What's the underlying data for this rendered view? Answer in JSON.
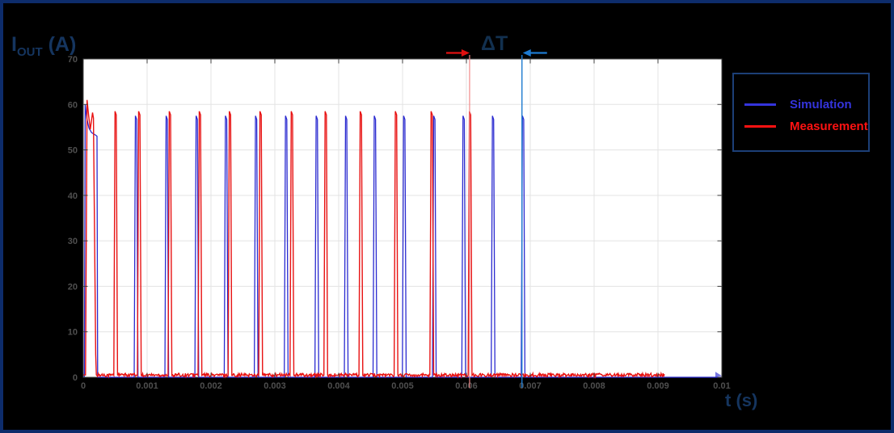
{
  "figure": {
    "background": "#000000",
    "border_color": "#0d2c6b"
  },
  "colors": {
    "plot_background": "#ffffff",
    "grid": "#e3e3e3",
    "axis_box": "#474747",
    "tick_text": "#4f4f4f",
    "axis_title_text": "#15355f",
    "simulation_line": "#2b2bd0",
    "measurement_line": "#e81212",
    "measurement_marker_arrow": "#e01010",
    "measurement_marker_line": "#f08888",
    "simulation_marker": "#1d7ad0"
  },
  "chart_data": {
    "type": "line",
    "title": "",
    "xlabel": "t (s)",
    "ylabel": "I_OUT (A)",
    "ylabel_parts": {
      "base": "I",
      "sub": "OUT",
      "rest": " (A)"
    },
    "xlim": [
      0,
      0.01
    ],
    "ylim": [
      0,
      70
    ],
    "grid": true,
    "legend_position": "outside upper right, black box",
    "x_ticks": {
      "values": [
        0,
        0.001,
        0.002,
        0.003,
        0.004,
        0.005,
        0.006,
        0.007,
        0.008,
        0.009,
        0.01
      ],
      "labels": [
        "0",
        "0.001",
        "0.002",
        "0.003",
        "0.004",
        "0.005",
        "0.006",
        "0.007",
        "0.008",
        "0.009",
        "0.01"
      ]
    },
    "y_ticks": {
      "values": [
        0,
        10,
        20,
        30,
        40,
        50,
        60,
        70
      ],
      "labels": [
        "0",
        "10",
        "20",
        "30",
        "40",
        "50",
        "60",
        "70"
      ]
    },
    "series": [
      {
        "name": "Simulation",
        "color": "#2b2bd0",
        "baseline_a": 0,
        "pulse_height_a": 57.5,
        "pulse_base_width_s": 6e-05,
        "first_pulse_t_v": [
          [
            1.8e-05,
            0
          ],
          [
            3e-05,
            60
          ],
          [
            5.5e-05,
            57
          ],
          [
            9e-05,
            54.8
          ],
          [
            0.00013,
            53.8
          ],
          [
            0.0002,
            53.2
          ],
          [
            0.000215,
            53
          ],
          [
            0.000225,
            0
          ]
        ],
        "pulse_centers_s": [
          0.00083,
          0.00131,
          0.00178,
          0.00224,
          0.00271,
          0.00318,
          0.00366,
          0.00412,
          0.00457,
          0.00503,
          0.0055,
          0.00596,
          0.00642,
          0.00689
        ],
        "data_end_s": 0.01
      },
      {
        "name": "Measurement",
        "color": "#e81212",
        "baseline_a": 0.5,
        "noise_amp_a": 0.75,
        "pulse_height_a": 58.5,
        "pulse_base_width_s": 6e-05,
        "first_pulse_t_v": [
          [
            3.5e-05,
            0.5
          ],
          [
            6e-05,
            61
          ],
          [
            8.5e-05,
            57.5
          ],
          [
            0.00011,
            54.5
          ],
          [
            0.000145,
            58.2
          ],
          [
            0.00016,
            57
          ],
          [
            0.000195,
            5
          ],
          [
            0.000205,
            0.5
          ]
        ],
        "pulse_centers_s": [
          0.00051,
          0.00088,
          0.00136,
          0.00183,
          0.0023,
          0.00278,
          0.00327,
          0.0038,
          0.00435,
          0.0049,
          0.00546,
          0.00606
        ],
        "data_end_s": 0.0091
      }
    ],
    "annotations": {
      "delta_t_label": "ΔT",
      "measurement_marker_t_s": 0.00605,
      "simulation_marker_t_s": 0.00687
    }
  },
  "legend": {
    "items": [
      {
        "label": "Simulation",
        "color": "#3434dc"
      },
      {
        "label": "Measurement",
        "color": "#ff1212"
      }
    ]
  }
}
